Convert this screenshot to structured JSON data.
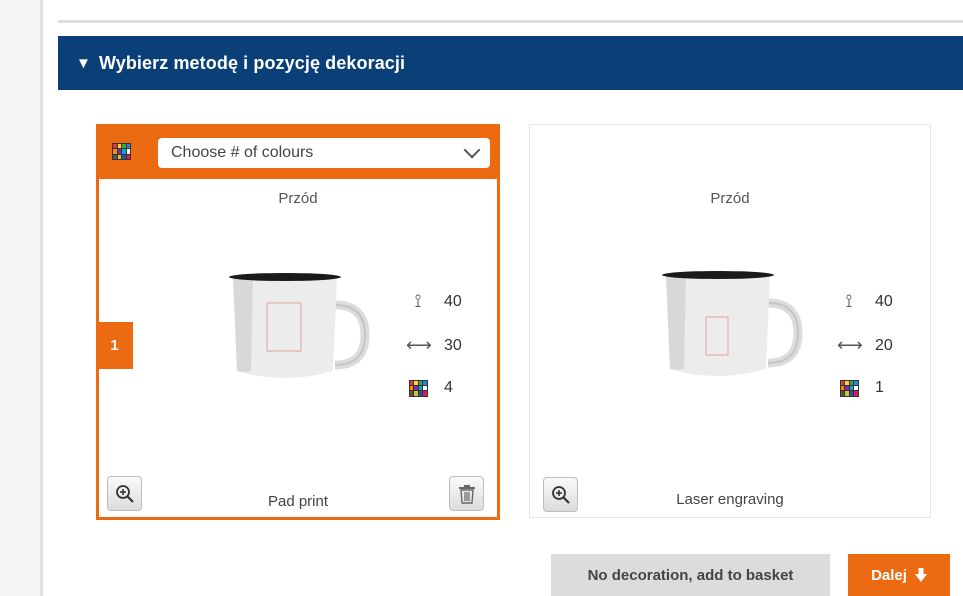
{
  "section": {
    "title": "Wybierz metodę i pozycję dekoracji",
    "arrow": "▼"
  },
  "cards": [
    {
      "position_label": "Przód",
      "select_value": "Choose # of colours",
      "number": "1",
      "height": "40",
      "width": "30",
      "colours": "4",
      "method": "Pad print"
    },
    {
      "position_label": "Przód",
      "height": "40",
      "width": "20",
      "colours": "1",
      "method": "Laser engraving"
    }
  ],
  "actions": {
    "no_decoration": "No decoration, add to basket",
    "next": "Dalej"
  },
  "colors": {
    "accent": "#ec6a12",
    "header": "#0b3f78"
  },
  "icons": [
    "palette-icon",
    "chevron-down-icon",
    "zoom-in-icon",
    "trash-icon",
    "height-icon",
    "width-icon",
    "arrow-down-icon"
  ]
}
